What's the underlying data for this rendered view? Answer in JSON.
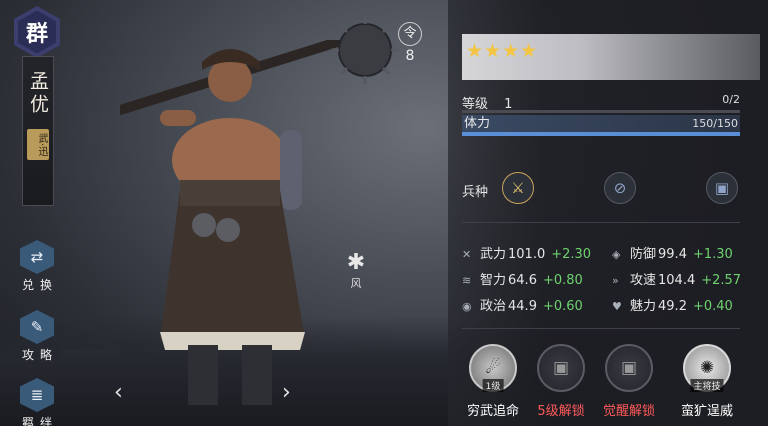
{
  "hero": {
    "faction": "群",
    "name": "孟优",
    "trait": "武·迅",
    "order_symbol": "令",
    "order_count": "8",
    "leaf_label": "风"
  },
  "side_buttons": [
    {
      "label": "兑换",
      "icon": "exchange-icon"
    },
    {
      "label": "攻略",
      "icon": "guide-scroll-icon"
    },
    {
      "label": "羁绊",
      "icon": "bond-icon"
    }
  ],
  "panel": {
    "stars": "★★★★",
    "star_count": 4,
    "level_label": "等级",
    "level_value": "1",
    "level_progress": "0/2",
    "hp_label": "体力",
    "hp_value": "150/150",
    "hp_fraction": 1.0,
    "troop_label": "兵种",
    "troop_icons": [
      "sword-icon",
      "shield-icon",
      "armor-icon"
    ]
  },
  "stats": [
    {
      "name": "武力",
      "value": "101.0",
      "growth": "+2.30",
      "icon": "crossed-swords-icon"
    },
    {
      "name": "防御",
      "value": "99.4",
      "growth": "+1.30",
      "icon": "shield-icon"
    },
    {
      "name": "智力",
      "value": "64.6",
      "growth": "+0.80",
      "icon": "brain-icon"
    },
    {
      "name": "攻速",
      "value": "104.4",
      "growth": "+2.57",
      "icon": "speed-icon"
    },
    {
      "name": "政治",
      "value": "44.9",
      "growth": "+0.60",
      "icon": "politics-icon"
    },
    {
      "name": "魅力",
      "value": "49.2",
      "growth": "+0.40",
      "icon": "charm-icon"
    }
  ],
  "skills": [
    {
      "name": "穷武追命",
      "tag": "1级",
      "color": "#ffffff"
    },
    {
      "name": "5级解锁",
      "tag": "",
      "color": "#ff5a5a"
    },
    {
      "name": "觉醒解锁",
      "tag": "",
      "color": "#ff5a5a"
    },
    {
      "name": "蛮犷逞威",
      "tag": "主将技",
      "color": "#ffffff"
    }
  ],
  "colors": {
    "accent_blue": "#5a8fd6",
    "growth_green": "#6fd16f",
    "locked_red": "#ff5a5a",
    "star_gold": "#f4c542",
    "faction_purple": "#3c3f6e"
  }
}
